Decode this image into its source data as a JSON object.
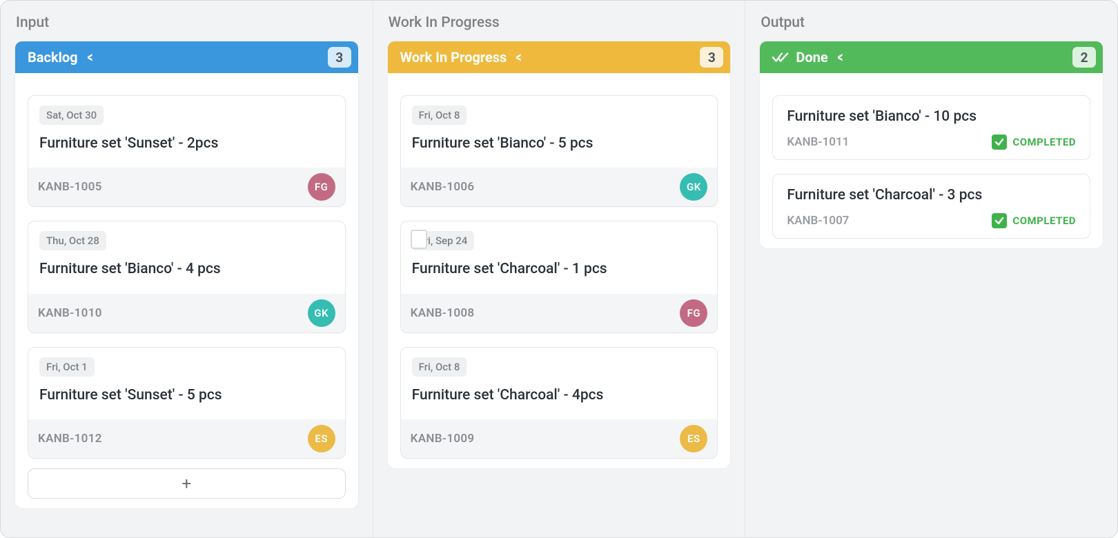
{
  "lanes": [
    {
      "title": "Input"
    },
    {
      "title": "Work In Progress"
    },
    {
      "title": "Output"
    }
  ],
  "columns": {
    "backlog": {
      "label": "Backlog",
      "count": "3",
      "cards": [
        {
          "date": "Sat, Oct 30",
          "title": "Furniture set 'Sunset' - 2pcs",
          "id": "KANB-1005",
          "avatar": "FG"
        },
        {
          "date": "Thu, Oct 28",
          "title": "Furniture set 'Bianco' - 4 pcs",
          "id": "KANB-1010",
          "avatar": "GK"
        },
        {
          "date": "Fri, Oct 1",
          "title": "Furniture set 'Sunset' - 5 pcs",
          "id": "KANB-1012",
          "avatar": "ES"
        }
      ]
    },
    "wip": {
      "label": "Work In Progress",
      "count": "3",
      "cards": [
        {
          "date": "Fri, Oct 8",
          "title": "Furniture set 'Bianco' - 5 pcs",
          "id": "KANB-1006",
          "avatar": "GK"
        },
        {
          "date": "Fri, Sep 24",
          "title": "Furniture set 'Charcoal' - 1 pcs",
          "id": "KANB-1008",
          "avatar": "FG",
          "flag": true
        },
        {
          "date": "Fri, Oct 8",
          "title": "Furniture set 'Charcoal' - 4pcs",
          "id": "KANB-1009",
          "avatar": "ES"
        }
      ]
    },
    "done": {
      "label": "Done",
      "count": "2",
      "completed_label": "COMPLETED",
      "cards": [
        {
          "title": "Furniture set 'Bianco' - 10 pcs",
          "id": "KANB-1011"
        },
        {
          "title": "Furniture set 'Charcoal' - 3 pcs",
          "id": "KANB-1007"
        }
      ]
    }
  },
  "add_label": "+"
}
